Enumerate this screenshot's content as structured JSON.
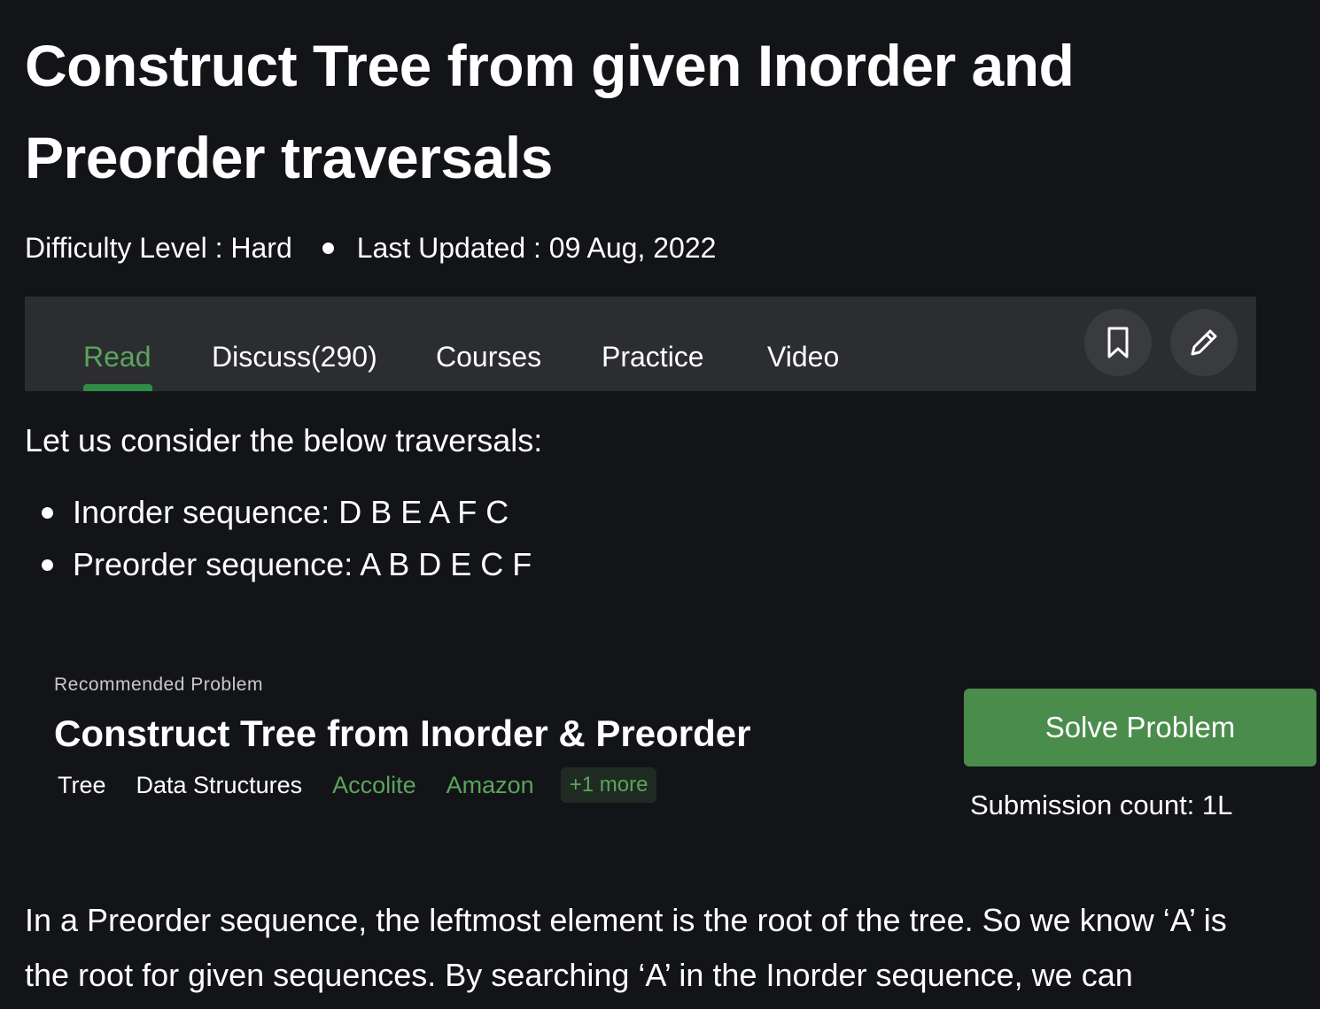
{
  "article": {
    "title": "Construct Tree from given Inorder and Preorder traversals",
    "difficulty": "Difficulty Level : Hard",
    "last_updated": "Last Updated : 09 Aug, 2022"
  },
  "tabs": [
    {
      "label": "Read",
      "active": true
    },
    {
      "label": "Discuss(290)",
      "active": false
    },
    {
      "label": "Courses",
      "active": false
    },
    {
      "label": "Practice",
      "active": false
    },
    {
      "label": "Video",
      "active": false
    }
  ],
  "toolbar": {
    "bookmark_icon": "bookmark-icon",
    "edit_icon": "pencil-icon"
  },
  "content": {
    "intro": "Let us consider the below traversals:",
    "sequences": [
      "Inorder sequence: D B E A F C",
      "Preorder sequence: A B D E C F"
    ],
    "paragraph": "In a Preorder sequence, the leftmost element is the root of the tree. So we know ‘A’ is the root for given sequences. By searching ‘A’ in the Inorder sequence, we can"
  },
  "recommended": {
    "label": "Recommended Problem",
    "title": "Construct Tree from Inorder & Preorder",
    "tags": [
      "Tree",
      "Data Structures"
    ],
    "companies": [
      "Accolite",
      "Amazon"
    ],
    "more": "+1 more",
    "solve_label": "Solve Problem",
    "submission_count": "Submission count: 1L"
  },
  "colors": {
    "background": "#131417",
    "tabbar": "#2c2d30",
    "accent_green": "#5aa45d",
    "button_green": "#4a8c4c"
  }
}
